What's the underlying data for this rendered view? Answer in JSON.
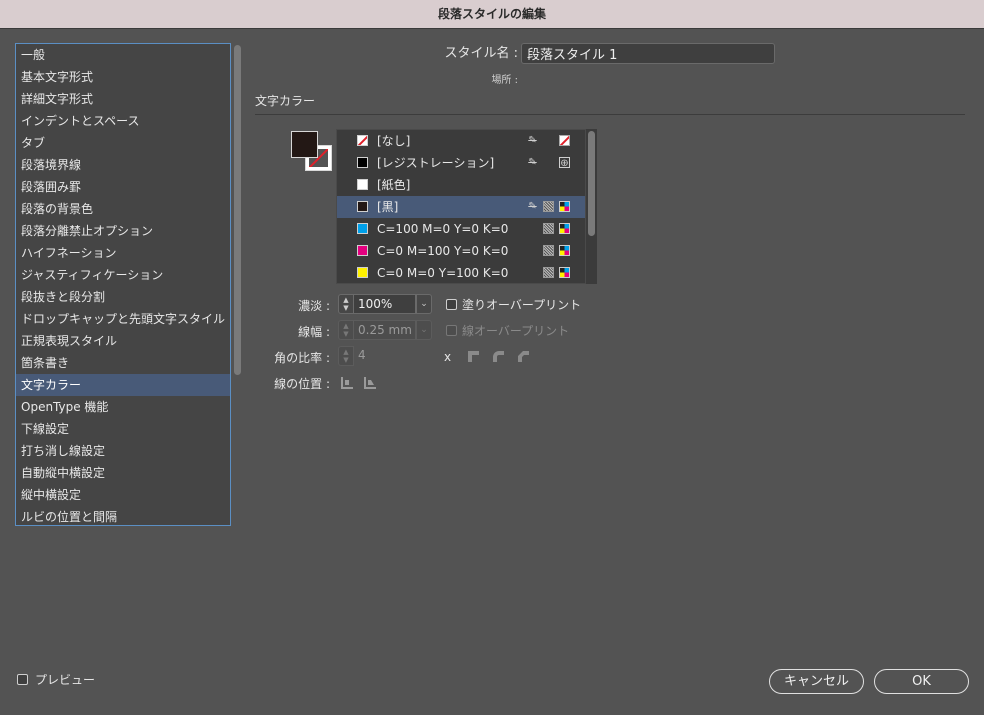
{
  "window": {
    "title": "段落スタイルの編集"
  },
  "sidebar": {
    "items": [
      {
        "label": "一般"
      },
      {
        "label": "基本文字形式"
      },
      {
        "label": "詳細文字形式"
      },
      {
        "label": "インデントとスペース"
      },
      {
        "label": "タブ"
      },
      {
        "label": "段落境界線"
      },
      {
        "label": "段落囲み罫"
      },
      {
        "label": "段落の背景色"
      },
      {
        "label": "段落分離禁止オプション"
      },
      {
        "label": "ハイフネーション"
      },
      {
        "label": "ジャスティフィケーション"
      },
      {
        "label": "段抜きと段分割"
      },
      {
        "label": "ドロップキャップと先頭文字スタイル"
      },
      {
        "label": "正規表現スタイル"
      },
      {
        "label": "箇条書き"
      },
      {
        "label": "文字カラー"
      },
      {
        "label": "OpenType 機能"
      },
      {
        "label": "下線設定"
      },
      {
        "label": "打ち消し線設定"
      },
      {
        "label": "自動縦中横設定"
      },
      {
        "label": "縦中横設定"
      },
      {
        "label": "ルビの位置と間隔"
      }
    ],
    "selected_index": 15
  },
  "header": {
    "style_name_label": "スタイル名 :",
    "style_name_value": "段落スタイル 1",
    "location_label": "場所 :"
  },
  "section": {
    "title": "文字カラー"
  },
  "swatches": [
    {
      "name": "[なし]",
      "color": "none",
      "lock": true,
      "type": "none"
    },
    {
      "name": "[レジストレーション]",
      "color": "#000000",
      "lock": true,
      "type": "registration"
    },
    {
      "name": "[紙色]",
      "color": "#ffffff",
      "lock": false,
      "type": ""
    },
    {
      "name": "[黒]",
      "color": "#231815",
      "lock": true,
      "type": "process-cmyk",
      "selected": true
    },
    {
      "name": "C=100 M=0 Y=0 K=0",
      "color": "#00a0e9",
      "lock": false,
      "type": "process-cmyk"
    },
    {
      "name": "C=0 M=100 Y=0 K=0",
      "color": "#e4007f",
      "lock": false,
      "type": "process-cmyk"
    },
    {
      "name": "C=0 M=0 Y=100 K=0",
      "color": "#fff100",
      "lock": false,
      "type": "process-cmyk"
    }
  ],
  "controls": {
    "tint_label": "濃淡 :",
    "tint_value": "100%",
    "overprint_fill_label": "塗りオーバープリント",
    "stroke_weight_label": "線幅 :",
    "stroke_weight_value": "0.25 mm",
    "overprint_stroke_label": "線オーバープリント",
    "miter_label": "角の比率 :",
    "miter_value": "4",
    "miter_suffix": "x",
    "stroke_pos_label": "線の位置 :"
  },
  "footer": {
    "preview_label": "プレビュー",
    "cancel_label": "キャンセル",
    "ok_label": "OK"
  }
}
